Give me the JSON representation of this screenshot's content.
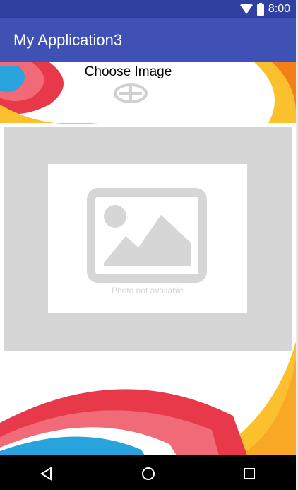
{
  "status_bar": {
    "time": "8:00",
    "icons": [
      "wifi-icon",
      "battery-icon"
    ]
  },
  "app_bar": {
    "title": "My Application3"
  },
  "content": {
    "choose_label": "Choose Image",
    "add_icon": "add-circle-icon",
    "placeholder_text": "Photo not available"
  },
  "nav_bar": {
    "buttons": [
      "back-icon",
      "home-icon",
      "recents-icon"
    ]
  },
  "colors": {
    "status_bar": "#2f40a0",
    "app_bar": "#3f51b5",
    "nav_bar": "#000000",
    "placeholder_frame": "#d6d6d6",
    "swoosh_red": "#e8394a",
    "swoosh_blue": "#29a3dc",
    "swoosh_yellow": "#fbc02d"
  }
}
